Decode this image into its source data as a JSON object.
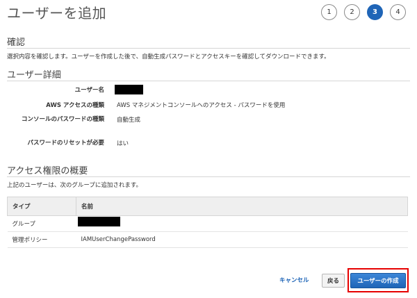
{
  "page": {
    "title": "ユーザーを追加"
  },
  "steps": [
    "1",
    "2",
    "3",
    "4"
  ],
  "review": {
    "heading": "確認",
    "description": "選択内容を確認します。ユーザーを作成した後で、自動生成パスワードとアクセスキーを確認してダウンロードできます。"
  },
  "user_details": {
    "heading": "ユーザー詳細",
    "rows": [
      {
        "key": "ユーザー名",
        "value": ""
      },
      {
        "key": "AWS アクセスの種類",
        "value": "AWS マネジメントコンソールへのアクセス - パスワードを使用"
      },
      {
        "key": "コンソールのパスワードの種類",
        "value": "自動生成"
      },
      {
        "key": "パスワードのリセットが必要",
        "value": "はい"
      }
    ]
  },
  "permissions": {
    "heading": "アクセス権限の概要",
    "description": "上記のユーザーは、次のグループに追加されます。",
    "columns": [
      "タイプ",
      "名前"
    ],
    "rows": [
      {
        "type": "グループ",
        "name": ""
      },
      {
        "type": "管理ポリシー",
        "name": "IAMUserChangePassword"
      }
    ]
  },
  "actions": {
    "cancel": "キャンセル",
    "back": "戻る",
    "create": "ユーザーの作成"
  },
  "colors": {
    "accent": "#1f65b7",
    "highlight": "#e60000"
  }
}
